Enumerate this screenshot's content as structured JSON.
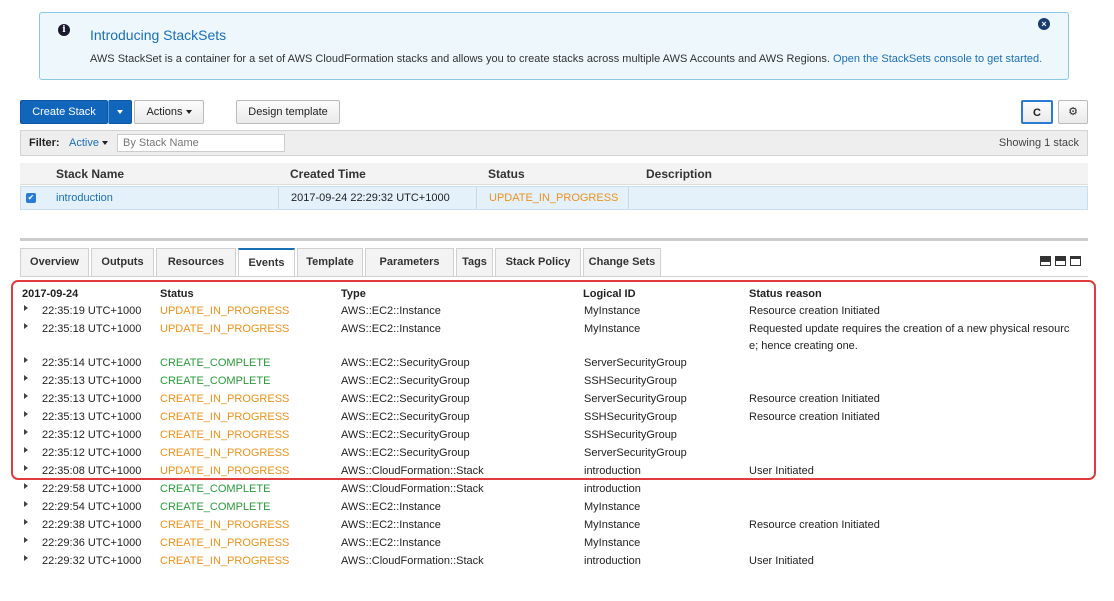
{
  "banner": {
    "title": "Introducing StackSets",
    "body": "AWS StackSet is a container for a set of AWS CloudFormation stacks and allows you to create stacks across multiple AWS Accounts and AWS Regions.",
    "link": "Open the StackSets console to get started."
  },
  "toolbar": {
    "create_stack": "Create Stack",
    "actions": "Actions",
    "design_template": "Design template",
    "refresh_glyph": "C",
    "settings_glyph": "⚙"
  },
  "filter": {
    "label": "Filter:",
    "active": "Active",
    "placeholder": "By Stack Name",
    "showing": "Showing 1 stack"
  },
  "stacks": {
    "headers": [
      "Stack Name",
      "Created Time",
      "Status",
      "Description"
    ],
    "rows": [
      {
        "name": "introduction",
        "created": "2017-09-24 22:29:32 UTC+1000",
        "status": "UPDATE_IN_PROGRESS",
        "description": ""
      }
    ]
  },
  "tabs": [
    "Overview",
    "Outputs",
    "Resources",
    "Events",
    "Template",
    "Parameters",
    "Tags",
    "Stack Policy",
    "Change Sets"
  ],
  "active_tab": "Events",
  "events": {
    "headers": {
      "date": "2017-09-24",
      "status": "Status",
      "type": "Type",
      "logical_id": "Logical ID",
      "reason": "Status reason"
    },
    "rows": [
      {
        "time": "22:35:19 UTC+1000",
        "status": "UPDATE_IN_PROGRESS",
        "type": "AWS::EC2::Instance",
        "logical_id": "MyInstance",
        "reason": "Resource creation Initiated"
      },
      {
        "time": "22:35:18 UTC+1000",
        "status": "UPDATE_IN_PROGRESS",
        "type": "AWS::EC2::Instance",
        "logical_id": "MyInstance",
        "reason": "Requested update requires the creation of a new physical resourc",
        "reason2": "e; hence creating one."
      },
      {
        "time": "22:35:14 UTC+1000",
        "status": "CREATE_COMPLETE",
        "type": "AWS::EC2::SecurityGroup",
        "logical_id": "ServerSecurityGroup",
        "reason": ""
      },
      {
        "time": "22:35:13 UTC+1000",
        "status": "CREATE_COMPLETE",
        "type": "AWS::EC2::SecurityGroup",
        "logical_id": "SSHSecurityGroup",
        "reason": ""
      },
      {
        "time": "22:35:13 UTC+1000",
        "status": "CREATE_IN_PROGRESS",
        "type": "AWS::EC2::SecurityGroup",
        "logical_id": "ServerSecurityGroup",
        "reason": "Resource creation Initiated"
      },
      {
        "time": "22:35:13 UTC+1000",
        "status": "CREATE_IN_PROGRESS",
        "type": "AWS::EC2::SecurityGroup",
        "logical_id": "SSHSecurityGroup",
        "reason": "Resource creation Initiated"
      },
      {
        "time": "22:35:12 UTC+1000",
        "status": "CREATE_IN_PROGRESS",
        "type": "AWS::EC2::SecurityGroup",
        "logical_id": "SSHSecurityGroup",
        "reason": ""
      },
      {
        "time": "22:35:12 UTC+1000",
        "status": "CREATE_IN_PROGRESS",
        "type": "AWS::EC2::SecurityGroup",
        "logical_id": "ServerSecurityGroup",
        "reason": ""
      },
      {
        "time": "22:35:08 UTC+1000",
        "status": "UPDATE_IN_PROGRESS",
        "type": "AWS::CloudFormation::Stack",
        "logical_id": "introduction",
        "reason": "User Initiated"
      },
      {
        "time": "22:29:58 UTC+1000",
        "status": "CREATE_COMPLETE",
        "type": "AWS::CloudFormation::Stack",
        "logical_id": "introduction",
        "reason": ""
      },
      {
        "time": "22:29:54 UTC+1000",
        "status": "CREATE_COMPLETE",
        "type": "AWS::EC2::Instance",
        "logical_id": "MyInstance",
        "reason": ""
      },
      {
        "time": "22:29:38 UTC+1000",
        "status": "CREATE_IN_PROGRESS",
        "type": "AWS::EC2::Instance",
        "logical_id": "MyInstance",
        "reason": "Resource creation Initiated"
      },
      {
        "time": "22:29:36 UTC+1000",
        "status": "CREATE_IN_PROGRESS",
        "type": "AWS::EC2::Instance",
        "logical_id": "MyInstance",
        "reason": ""
      },
      {
        "time": "22:29:32 UTC+1000",
        "status": "CREATE_IN_PROGRESS",
        "type": "AWS::CloudFormation::Stack",
        "logical_id": "introduction",
        "reason": "User Initiated"
      }
    ]
  },
  "colors": {
    "accent": "#1a6fb5",
    "in_progress": "#f0901a",
    "complete": "#2a9a3a",
    "highlight": "#e03c3c"
  }
}
